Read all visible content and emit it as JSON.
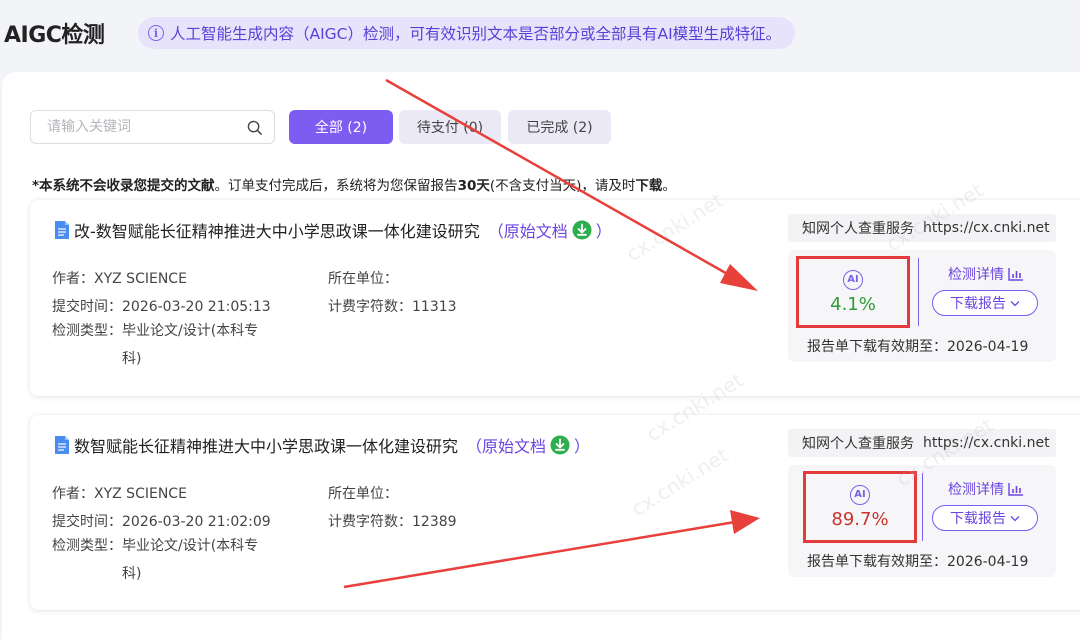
{
  "header": {
    "title": "AIGC检测",
    "info": "人工智能生成内容（AIGC）检测，可有效识别文本是否部分或全部具有AI模型生成特征。"
  },
  "search": {
    "placeholder": "请输入关键词",
    "value": ""
  },
  "tabs": [
    {
      "label": "全部 (2)",
      "active": true
    },
    {
      "label": "待支付 (0)",
      "active": false
    },
    {
      "label": "已完成 (2)",
      "active": false
    }
  ],
  "notice": {
    "p1": "*本系统不会收录您提交的文献",
    "p2": "。订单支付完成后，系统将为您保留报告",
    "p3": "30天",
    "p4": "(不含支付当天)，请及时",
    "p5": "下载",
    "p6": "。"
  },
  "labels": {
    "author": "作者：",
    "submit_time": "提交时间：",
    "check_type": "检测类型：",
    "unit": "所在单位：",
    "char_count": "计费字符数：",
    "original": "（原始文档",
    "paren_close": "）",
    "service": "知网个人查重服务",
    "service_url": "https://cx.cnki.net",
    "detail": "检测详情",
    "download": "下载报告",
    "expire_label": "报告单下载有效期至：",
    "ai_icon": "AI"
  },
  "records": [
    {
      "title": "改-数智赋能长征精神推进大中小学思政课一体化建设研究",
      "author": "XYZ SCIENCE",
      "submit_time": "2026-03-20 21:05:13",
      "check_type": "毕业论文/设计(本科专科)",
      "unit": "",
      "char_count": "11313",
      "score": "4.1%",
      "expire": "2026-04-19"
    },
    {
      "title": "数智赋能长征精神推进大中小学思政课一体化建设研究",
      "author": "XYZ SCIENCE",
      "submit_time": "2026-03-20 21:02:09",
      "check_type": "毕业论文/设计(本科专科)",
      "unit": "",
      "char_count": "12389",
      "score": "89.7%",
      "expire": "2026-04-19"
    }
  ],
  "watermark": "cx.cnki.net",
  "colors": {
    "accent": "#7d5cf2",
    "score_low": "#2f9a36",
    "score_high": "#c9342e",
    "highlight_border": "#e33b3b",
    "arrow": "#e8403a"
  },
  "icons": [
    "info-icon",
    "search-icon",
    "document-icon",
    "download-icon",
    "ai-icon",
    "chart-icon",
    "chevron-down-icon"
  ]
}
